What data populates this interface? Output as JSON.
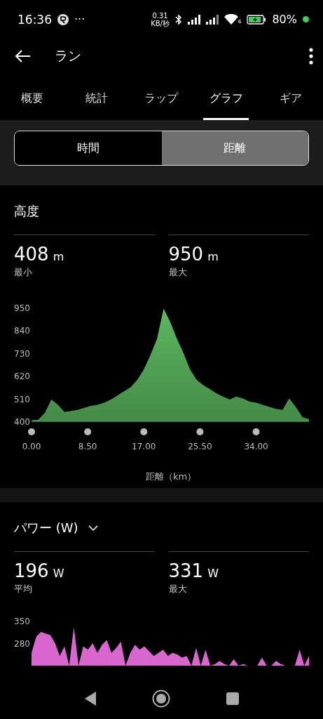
{
  "status_bar": {
    "time": "16:36",
    "more": "···",
    "speed_value": "0.31",
    "speed_unit": "KB/秒",
    "wifi_band": "6",
    "battery": "80%"
  },
  "header": {
    "title": "ラン"
  },
  "tabs": [
    {
      "label": "概要",
      "selected": false
    },
    {
      "label": "統計",
      "selected": false
    },
    {
      "label": "ラップ",
      "selected": false
    },
    {
      "label": "グラフ",
      "selected": true
    },
    {
      "label": "ギア",
      "selected": false
    }
  ],
  "segments": [
    {
      "label": "時間",
      "selected": false
    },
    {
      "label": "距離",
      "selected": true
    }
  ],
  "sections": [
    {
      "title": "高度",
      "stats": [
        {
          "value": "408",
          "unit": "m",
          "label": "最小"
        },
        {
          "value": "950",
          "unit": "m",
          "label": "最大"
        }
      ],
      "chart_data": {
        "type": "area",
        "xlabel": "距離（km）",
        "x": [
          0,
          1,
          2,
          3,
          4,
          5,
          6,
          7,
          8,
          9,
          10,
          11,
          12,
          13,
          14,
          15,
          16,
          17,
          18,
          19,
          20,
          21,
          22,
          23,
          24,
          25,
          26,
          27,
          28,
          29,
          30,
          31,
          32,
          33,
          34,
          35,
          36,
          37,
          38,
          39,
          40,
          41,
          42
        ],
        "series": [
          {
            "color": "#5cb85f",
            "values": [
              405,
              408,
              440,
              505,
              480,
              445,
              450,
              455,
              465,
              475,
              480,
              490,
              505,
              525,
              545,
              565,
              600,
              650,
              720,
              800,
              945,
              880,
              800,
              730,
              650,
              600,
              575,
              555,
              535,
              520,
              505,
              520,
              510,
              495,
              490,
              480,
              470,
              460,
              455,
              510,
              470,
              420,
              410
            ]
          }
        ],
        "xlim": [
          0,
          42
        ],
        "ylim": [
          400,
          950
        ],
        "xticks": [
          {
            "value": 0,
            "label": "0.00"
          },
          {
            "value": 8.5,
            "label": "8.50"
          },
          {
            "value": 17,
            "label": "17.00"
          },
          {
            "value": 25.5,
            "label": "25.50"
          },
          {
            "value": 34,
            "label": "34.00"
          }
        ],
        "yticks": [
          400,
          510,
          620,
          730,
          840,
          950
        ]
      }
    },
    {
      "title": "パワー (W)",
      "dropdown": true,
      "stats": [
        {
          "value": "196",
          "unit": "W",
          "label": "平均"
        },
        {
          "value": "331",
          "unit": "W",
          "label": "最大"
        }
      ],
      "axis_labels": [
        "350",
        "280"
      ]
    }
  ]
}
